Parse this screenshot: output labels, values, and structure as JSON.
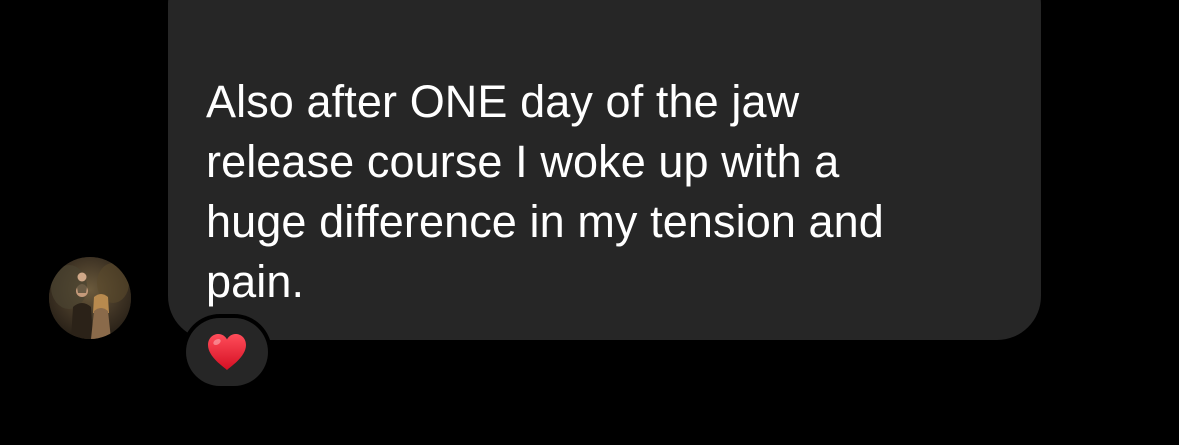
{
  "conversation": {
    "message": {
      "text": "Also after ONE day of the jaw\nrelease course I woke up with a\nhuge difference in my tension and\npain.",
      "reaction": {
        "icon": "red-heart-icon",
        "color": "#e8192c"
      }
    },
    "sender_avatar": {
      "icon": "profile-photo"
    }
  },
  "colors": {
    "background": "#000000",
    "bubble": "#262626",
    "text": "#ffffff"
  }
}
